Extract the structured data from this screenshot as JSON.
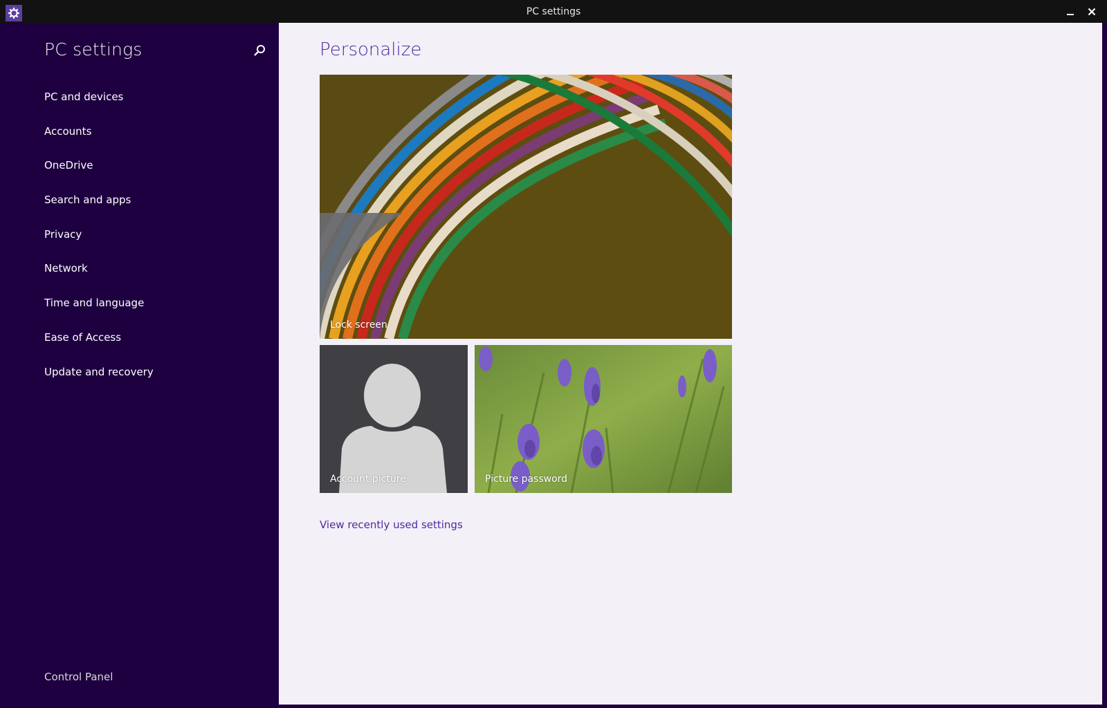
{
  "window": {
    "title": "PC settings",
    "icon": "gear-icon",
    "controls": [
      "minimize-icon",
      "close-icon"
    ]
  },
  "sidebar": {
    "title": "PC settings",
    "search_icon": "search-icon",
    "items": [
      {
        "label": "PC and devices"
      },
      {
        "label": "Accounts"
      },
      {
        "label": "OneDrive"
      },
      {
        "label": "Search and apps"
      },
      {
        "label": "Privacy"
      },
      {
        "label": "Network"
      },
      {
        "label": "Time and language"
      },
      {
        "label": "Ease of Access"
      },
      {
        "label": "Update and recovery"
      }
    ],
    "footer_link": "Control Panel"
  },
  "main": {
    "title": "Personalize",
    "tiles": [
      {
        "label": "Lock screen"
      },
      {
        "label": "Account picture"
      },
      {
        "label": "Picture password"
      }
    ],
    "recent_link": "View recently used settings"
  },
  "colors": {
    "sidebar_background": "#1e0040",
    "accent": "#4e2a9e",
    "content_background": "#f3f0f8",
    "titlebar": "#121212"
  }
}
